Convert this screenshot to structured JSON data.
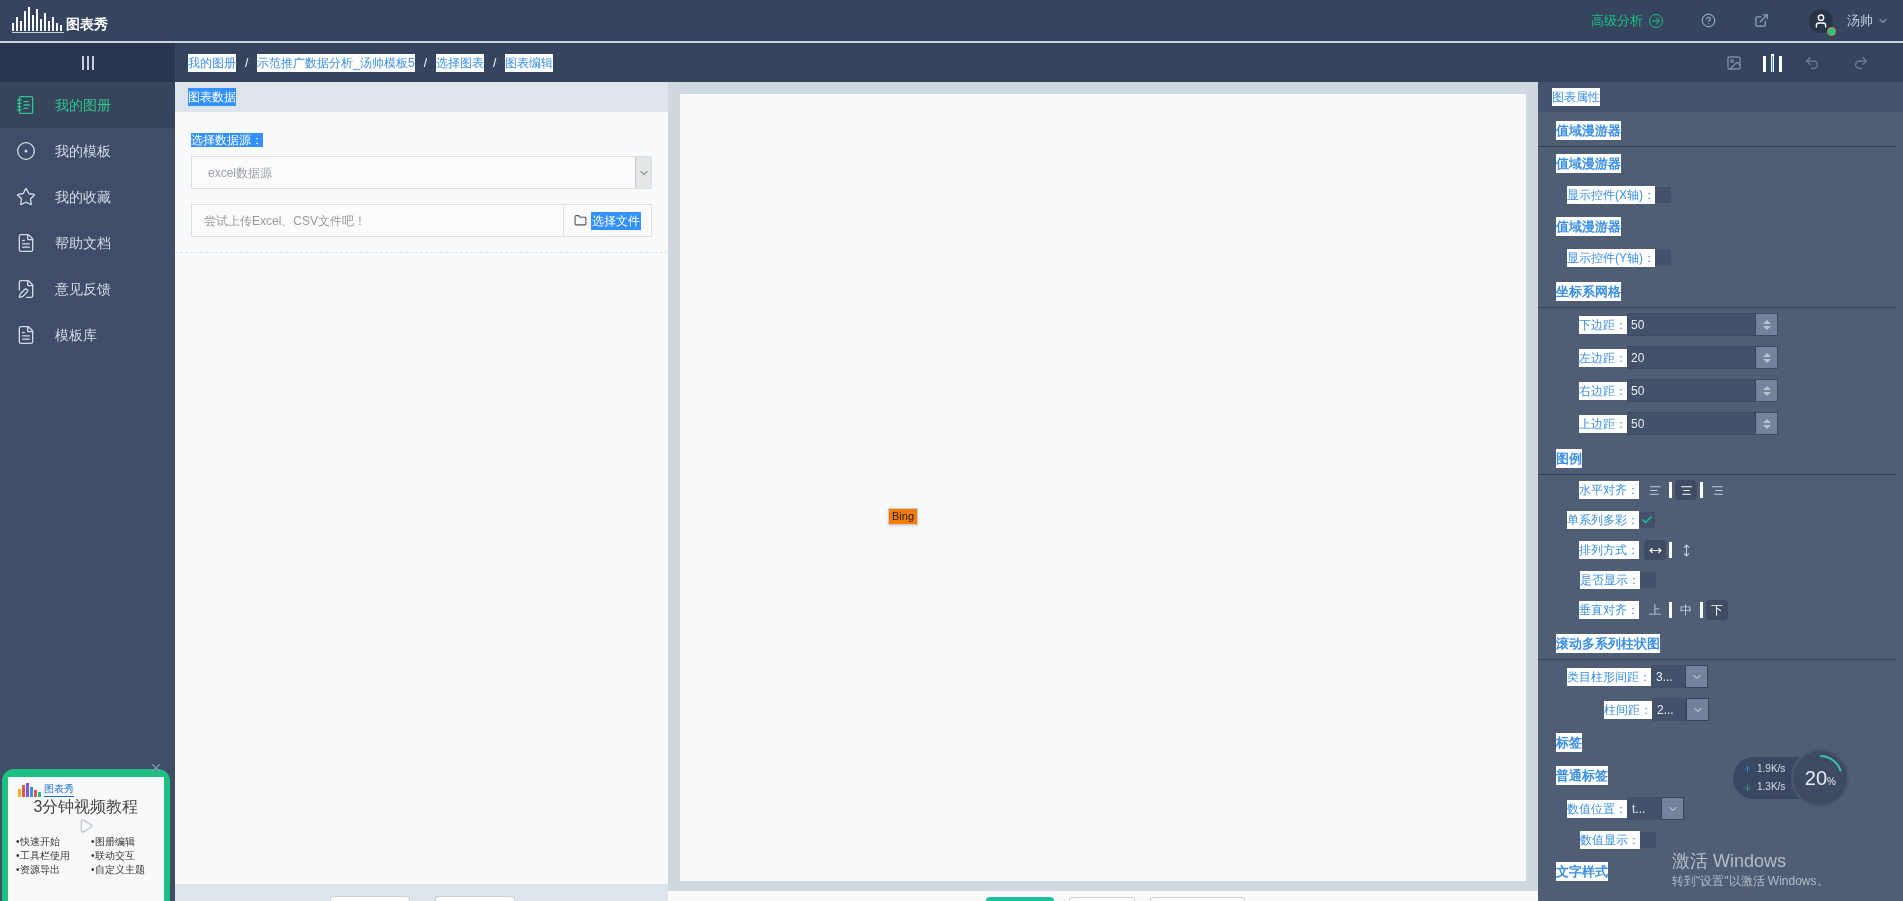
{
  "header": {
    "logo_text": "图表秀",
    "advanced": "高级分析",
    "user": "汤帅"
  },
  "sidebar": {
    "items": [
      {
        "label": "我的图册",
        "kind": "album",
        "selected": true
      },
      {
        "label": "我的模板",
        "kind": "template",
        "selected": false
      },
      {
        "label": "我的收藏",
        "kind": "star",
        "selected": false
      },
      {
        "label": "帮助文档",
        "kind": "doc",
        "selected": false
      },
      {
        "label": "意见反馈",
        "kind": "feedback",
        "selected": false
      },
      {
        "label": "模板库",
        "kind": "doc",
        "selected": false
      }
    ],
    "promo": {
      "brand": "图表秀",
      "title": "3分钟视频教程",
      "links": [
        "•快速开始",
        "•图册编辑",
        "•工具栏使用",
        "•联动交互",
        "•资源导出",
        "•自定义主题"
      ]
    }
  },
  "breadcrumbs": {
    "separator": "/",
    "items": [
      "我的图册",
      "示范推广数据分析_汤帅模板5",
      "选择图表",
      "图表编辑"
    ]
  },
  "data_panel": {
    "title": "图表数据",
    "source_label": "选择数据源：",
    "source_placeholder": "excel数据源",
    "upload_placeholder": "尝试上传Excel、CSV文件吧！",
    "upload_button": "选择文件"
  },
  "canvas": {
    "badge": "Bing"
  },
  "properties": {
    "title": "图表属性",
    "items": [
      {
        "kind": "section",
        "label": "值域漫游器"
      },
      {
        "kind": "subsection",
        "label": "值域漫游器"
      },
      {
        "kind": "toggle",
        "label": "显示控件(X轴)：",
        "checked": false
      },
      {
        "kind": "subsection",
        "label": "值域漫游器"
      },
      {
        "kind": "toggle",
        "label": "显示控件(Y轴)：",
        "checked": false
      },
      {
        "kind": "section",
        "label": "坐标系网格"
      },
      {
        "kind": "spinner",
        "label": "下边距：",
        "value": "50"
      },
      {
        "kind": "spinner",
        "label": "左边距：",
        "value": "20"
      },
      {
        "kind": "spinner",
        "label": "右边距：",
        "value": "50"
      },
      {
        "kind": "spinner",
        "label": "上边距：",
        "value": "50"
      },
      {
        "kind": "section",
        "label": "图例"
      },
      {
        "kind": "align",
        "label": "水平对齐：",
        "options": [
          {
            "kind": "left",
            "selected": false
          },
          {
            "kind": "center",
            "selected": true
          },
          {
            "kind": "right",
            "selected": false
          }
        ]
      },
      {
        "kind": "checkbox",
        "label": "单系列多彩：",
        "checked": true
      },
      {
        "kind": "align",
        "label": "排列方式：",
        "options": [
          {
            "kind": "horizontal",
            "selected": true
          },
          {
            "kind": "vertical",
            "selected": false
          }
        ]
      },
      {
        "kind": "toggle",
        "label": "是否显示：",
        "checked": false
      },
      {
        "kind": "align",
        "label": "垂直对齐：",
        "options": [
          {
            "kind": "text",
            "label": "上",
            "selected": false
          },
          {
            "kind": "text",
            "label": "中",
            "selected": false
          },
          {
            "kind": "text",
            "label": "下",
            "selected": true
          }
        ]
      },
      {
        "kind": "section",
        "label": "滚动多系列柱状图"
      },
      {
        "kind": "select",
        "label": "类目柱形间距：",
        "value": "3..."
      },
      {
        "kind": "select",
        "label": "柱间距：",
        "value": "2..."
      },
      {
        "kind": "subsection",
        "label": "标签"
      },
      {
        "kind": "subsection",
        "label": "普通标签"
      },
      {
        "kind": "select",
        "label": "数值位置：",
        "value": "t..."
      },
      {
        "kind": "toggle",
        "label": "数值显示：",
        "checked": false
      },
      {
        "kind": "subsection",
        "label": "文字样式"
      }
    ]
  },
  "net_widget": {
    "up": "1.9",
    "down": "1.3",
    "up_unit": "K/s",
    "down_unit": "K/s",
    "percent": "20",
    "percent_sign": "%"
  },
  "os_notice": {
    "title": "激活 Windows",
    "text": "转到\"设置\"以激活 Windows。"
  }
}
